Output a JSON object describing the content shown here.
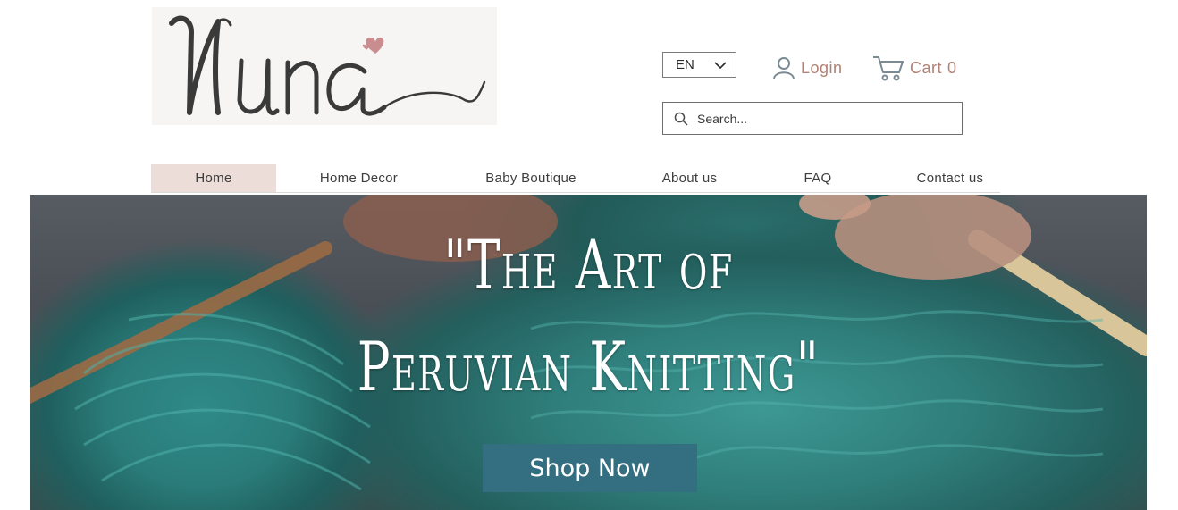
{
  "brand": {
    "logo_text": "Nuna"
  },
  "header": {
    "language": "EN",
    "login_label": "Login",
    "cart_label": "Cart",
    "cart_count": "0",
    "search_placeholder": "Search..."
  },
  "nav": {
    "items": [
      {
        "label": "Home",
        "active": true
      },
      {
        "label": "Home Decor",
        "active": false
      },
      {
        "label": "Baby Boutique",
        "active": false
      },
      {
        "label": "About us",
        "active": false
      },
      {
        "label": "FAQ",
        "active": false
      },
      {
        "label": "Contact us",
        "active": false
      }
    ]
  },
  "hero": {
    "title_line1": "\"The Art of",
    "title_line2": "Peruvian Knitting\"",
    "cta_label": "Shop Now"
  },
  "colors": {
    "accent_text": "#b08174",
    "nav_active_bg": "#ecddd8",
    "cta_bg": "#336f80",
    "logo_heart": "#c98d90",
    "icon_gray": "#7a8b93"
  },
  "icons": {
    "search": "search-icon",
    "user": "user-icon",
    "cart": "cart-icon",
    "chevron": "chevron-down-icon",
    "heart": "heart-icon"
  }
}
